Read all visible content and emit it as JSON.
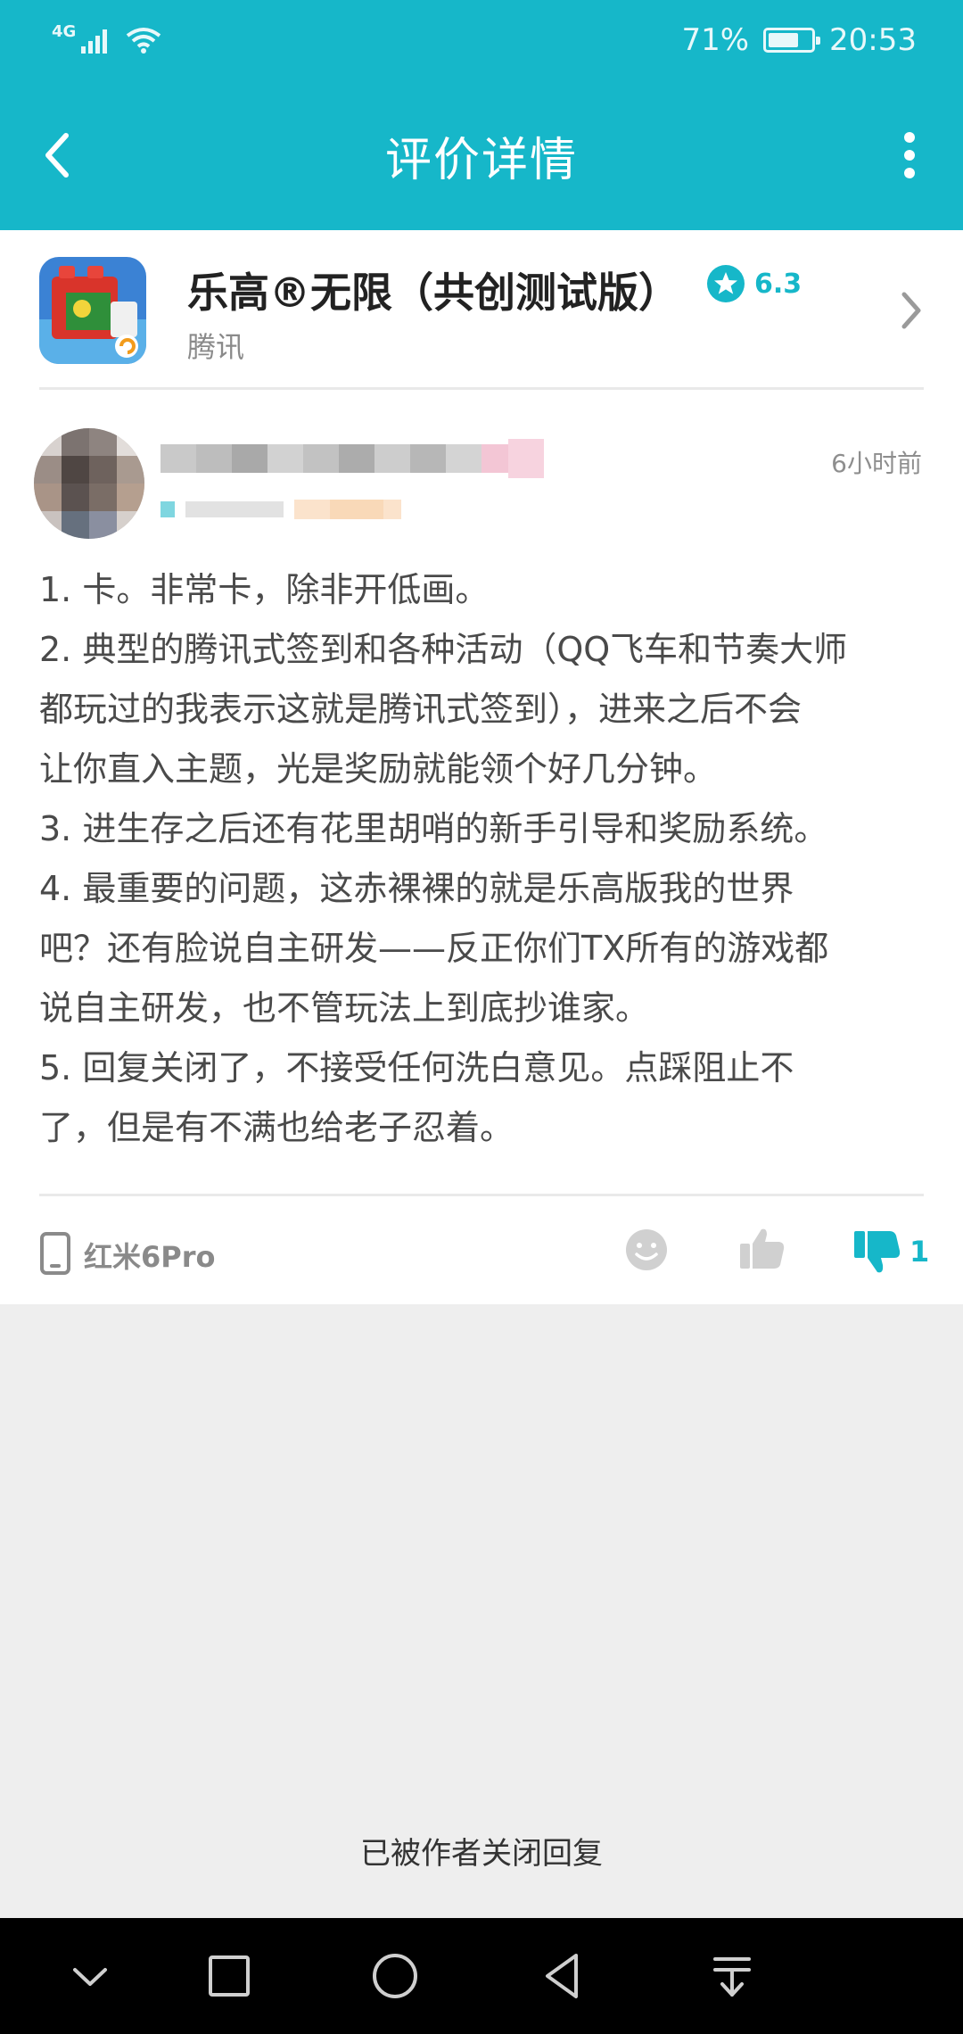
{
  "status_bar": {
    "network": "4G",
    "battery_percent": "71%",
    "time": "20:53",
    "battery_level": 0.71
  },
  "header": {
    "title": "评价详情",
    "back_icon": "chevron-left-icon",
    "more_icon": "more-vertical-icon"
  },
  "app": {
    "name": "乐高®无限（共创测试版）",
    "rating": "6.3",
    "developer": "腾讯"
  },
  "review": {
    "time_ago": "6小时前",
    "lines": [
      "1. 卡。非常卡，除非开低画。",
      "2. 典型的腾讯式签到和各种活动（QQ飞车和节奏大师",
      "都玩过的我表示这就是腾讯式签到），进来之后不会",
      "让你直入主题，光是奖励就能领个好几分钟。",
      "3. 进生存之后还有花里胡哨的新手引导和奖励系统。",
      "4. 最重要的问题，这赤裸裸的就是乐高版我的世界",
      "吧？还有脸说自主研发——反正你们TX所有的游戏都",
      "说自主研发，也不管玩法上到底抄谁家。",
      "5. 回复关闭了，不接受任何洗白意见。点踩阻止不",
      "了，但是有不满也给老子忍着。"
    ],
    "device": "红米6Pro",
    "dislike_count": "1"
  },
  "closed_notice": "已被作者关闭回复",
  "colors": {
    "accent": "#16b7c9",
    "background": "#eeeeee"
  }
}
